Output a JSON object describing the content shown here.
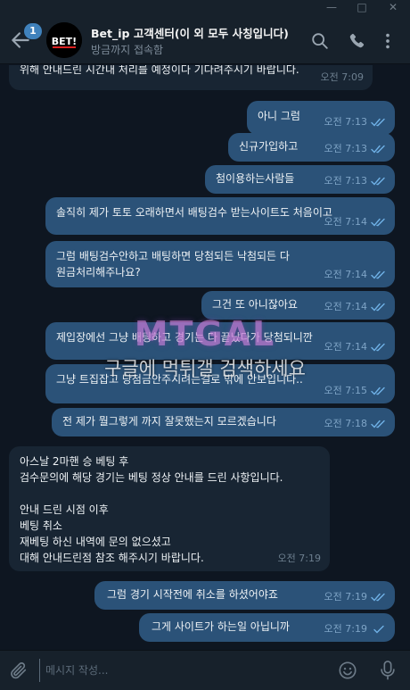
{
  "header": {
    "title": "Bet_ip 고객센터(이 외 모두 사칭입니다)",
    "status": "방금까지 접속함",
    "unread_badge": "1",
    "avatar_text": "BET!"
  },
  "messages": [
    {
      "dir": "in",
      "text": "위해 안내드린 시간내 처리를 예정이다 기다려주시기 바랍니다.",
      "time": "오전 7:09"
    },
    {
      "dir": "out",
      "text": "아니 그럼",
      "time": "오전 7:13"
    },
    {
      "dir": "out",
      "text": "신규가입하고",
      "time": "오전 7:13"
    },
    {
      "dir": "out",
      "text": "첨이용하는사람들",
      "time": "오전 7:13"
    },
    {
      "dir": "out",
      "text": "솔직히 제가 토토 오래하면서 배팅검수 받는사이트도 처음이고",
      "time": "오전 7:14"
    },
    {
      "dir": "out",
      "lines": [
        "그럼 배팅검수안하고 배팅하면 당첨되든 낙첨되든 다",
        "원금처리해주나요?"
      ],
      "time": "오전 7:14"
    },
    {
      "dir": "out",
      "text": "그건 또 아니잖아요",
      "time": "오전 7:14"
    },
    {
      "dir": "out",
      "text": "제입장에선 그냥 배팅하고 경기는 다 끝났다가 당첨되니깐",
      "time": "오전 7:14"
    },
    {
      "dir": "out",
      "text": "그냥 트집잡고 당첨금안주시려는걸로 밖에 안보입니다..",
      "time": "오전 7:15"
    },
    {
      "dir": "out",
      "text": "전 제가 뭘그렇게 까지 잘못했는지 모르겠습니다",
      "time": "오전 7:18"
    },
    {
      "dir": "in",
      "lines": [
        "아스날 2마핸 승 베팅 후",
        "검수문의에 해당 경기는 베팅 정상 안내를 드린 사항입니다.",
        "",
        "안내 드린 시점 이후",
        "베팅 취소",
        "재베팅 하신 내역에 문의 없으셨고",
        "대해 안내드린점 참조 해주시기 바랍니다."
      ],
      "time": "오전 7:19"
    },
    {
      "dir": "out",
      "text": "그럼 경기 시작전에 취소를 하셨어야죠",
      "time": "오전 7:19"
    },
    {
      "dir": "out",
      "text": "그게 사이트가 하는일 아닙니까",
      "time": "오전 7:19"
    }
  ],
  "watermark": {
    "logo": "MTGAL",
    "text": "구글에 먹튀갤 검색하세요"
  },
  "composer": {
    "placeholder": "메시지 작성..."
  },
  "icons": {
    "back": "arrow-left-icon",
    "search": "search-icon",
    "call": "phone-icon",
    "menu": "more-vertical-icon",
    "attach": "paperclip-icon",
    "emoji": "smile-icon",
    "voice": "microphone-icon",
    "read": "double-check-icon"
  },
  "colors": {
    "background": "#0e1621",
    "header": "#17212b",
    "incoming_bubble": "#182533",
    "outgoing_bubble": "#2b5278",
    "accent": "#4082bc"
  }
}
